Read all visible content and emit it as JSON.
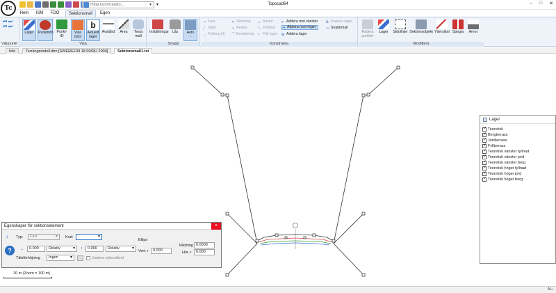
{
  "app": {
    "title": "Topocad64",
    "logo_text": "Tc"
  },
  "toolbar": {
    "command_placeholder": "Hitta kommando...",
    "more": "▾"
  },
  "ribbon_tabs": [
    "Hem",
    "ISM",
    "FDO",
    "Sektionsmall",
    "Egen"
  ],
  "ribbon": {
    "nav_label": "Välj punkt",
    "groups": {
      "visa": {
        "label": "Visa",
        "buttons": [
          "Lager",
          "Punktinfo",
          "Punkt-ID",
          "Visa rutor",
          "Aktuellt lager",
          "Avstånd",
          "Area",
          "Testa mall"
        ]
      },
      "snapp": {
        "label": "Snapp",
        "buttons": [
          "Inställningar",
          "Lås",
          "Auto"
        ],
        "auto_sub": "-"
      },
      "konstruera": {
        "label": "Konstruera",
        "col1": [
          "Fast",
          "Slänt",
          "Förläng till"
        ],
        "col2": [
          "Skärning",
          "Relativ",
          "Bombering"
        ],
        "col3": [
          "Anslut",
          "Förbind",
          "Följ lager"
        ],
        "col4": [
          "Addera mot vänster",
          "Addera mot höger",
          "Addera lager"
        ],
        "col5": [
          "Kopiera lager",
          "Snabbmall"
        ]
      },
      "modifiera": {
        "label": "Modifiera",
        "buttons": [
          "Radera punkter",
          "Lager",
          "Sidolinjer",
          "Sektionsobjekt",
          "Ytterslänt",
          "Spegla",
          "Areor"
        ]
      }
    }
  },
  "doc_tabs": [
    "Info",
    "Terrängmodell.dtm [SWEREF99 18 00/RH 2000]",
    "Sektionsmall1.tst"
  ],
  "layer_panel": {
    "title": "Lager",
    "items": [
      "Teoretisk",
      "Bergterrass",
      "Jordterrass",
      "Fyllterrass",
      "Teoretisk vänster fyllnad",
      "Teoretisk vänster jord",
      "Teoretisk vänster berg",
      "Teoretisk höger fyllnad",
      "Teoretisk höger jord",
      "Teoretisk höger berg"
    ]
  },
  "properties": {
    "title": "Egenskaper för sektionselement",
    "close": "×",
    "typ_label": "Typ:",
    "typ_value": "Fast",
    "kod_label": "Kod:",
    "kod_value": "",
    "h_value": "0.000",
    "h_mode": "Relativ",
    "v_value": "0.000",
    "v_mode": "Relativ",
    "talfor_label": "Tälsförhöjning",
    "talfor_value": "Ingen",
    "justera_label": "Justera sidavstånd",
    "ellips_label": "Ellips",
    "vert_label": "Vert. r",
    "vert_value": "0.000",
    "riktning_label": "Riktning",
    "riktning_value": "0.0000",
    "hor_label": "Hor. r",
    "hor_value": "0.000",
    "help": "?"
  },
  "scale": {
    "text": "10 m (Zoom = 100 m)"
  },
  "status": {
    "right": "N∼"
  }
}
